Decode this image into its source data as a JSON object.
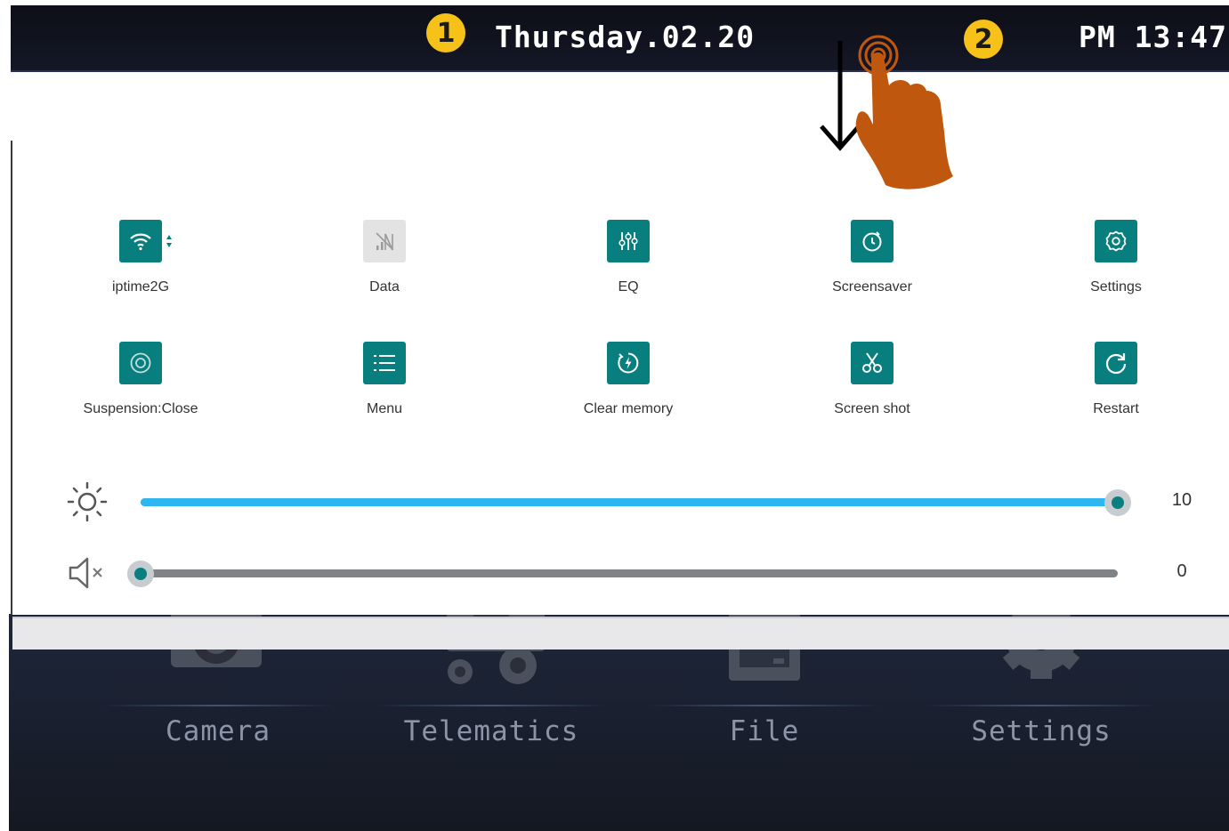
{
  "status_bar": {
    "date": "Thursday.02.20",
    "time": "PM 13:47",
    "marker_1": "1",
    "marker_2": "2"
  },
  "gesture": {
    "icon": "swipe-down-hand-icon",
    "arrow": "down-arrow-icon"
  },
  "quick_settings": {
    "tiles": [
      {
        "label": "iptime2G",
        "icon": "wifi-icon",
        "active": true
      },
      {
        "label": "Data",
        "icon": "mobile-data-off-icon",
        "active": false
      },
      {
        "label": "EQ",
        "icon": "equalizer-icon",
        "active": true
      },
      {
        "label": "Screensaver",
        "icon": "screensaver-clock-icon",
        "active": true
      },
      {
        "label": "Settings",
        "icon": "gear-icon",
        "active": true
      },
      {
        "label": "Suspension:Close",
        "icon": "suspension-circle-icon",
        "active": true
      },
      {
        "label": "Menu",
        "icon": "menu-list-icon",
        "active": true
      },
      {
        "label": "Clear memory",
        "icon": "clear-memory-bolt-icon",
        "active": true
      },
      {
        "label": "Screen shot",
        "icon": "scissors-icon",
        "active": true
      },
      {
        "label": "Restart",
        "icon": "restart-icon",
        "active": true
      }
    ],
    "brightness": {
      "icon": "brightness-sun-icon",
      "value": "10",
      "level": 1.0
    },
    "volume": {
      "icon": "volume-mute-icon",
      "value": "0",
      "level": 0.0
    }
  },
  "home_screen": {
    "apps": [
      {
        "label": "Camera",
        "icon": "camera-icon"
      },
      {
        "label": "Telematics",
        "icon": "tractor-icon"
      },
      {
        "label": "File",
        "icon": "file-icon"
      },
      {
        "label": "Settings",
        "icon": "gear-icon"
      }
    ]
  },
  "colors": {
    "tile_accent": "#087e7e",
    "brightness_fill": "#2eb6f0",
    "marker": "#f6c21a",
    "hand": "#c0570e"
  }
}
